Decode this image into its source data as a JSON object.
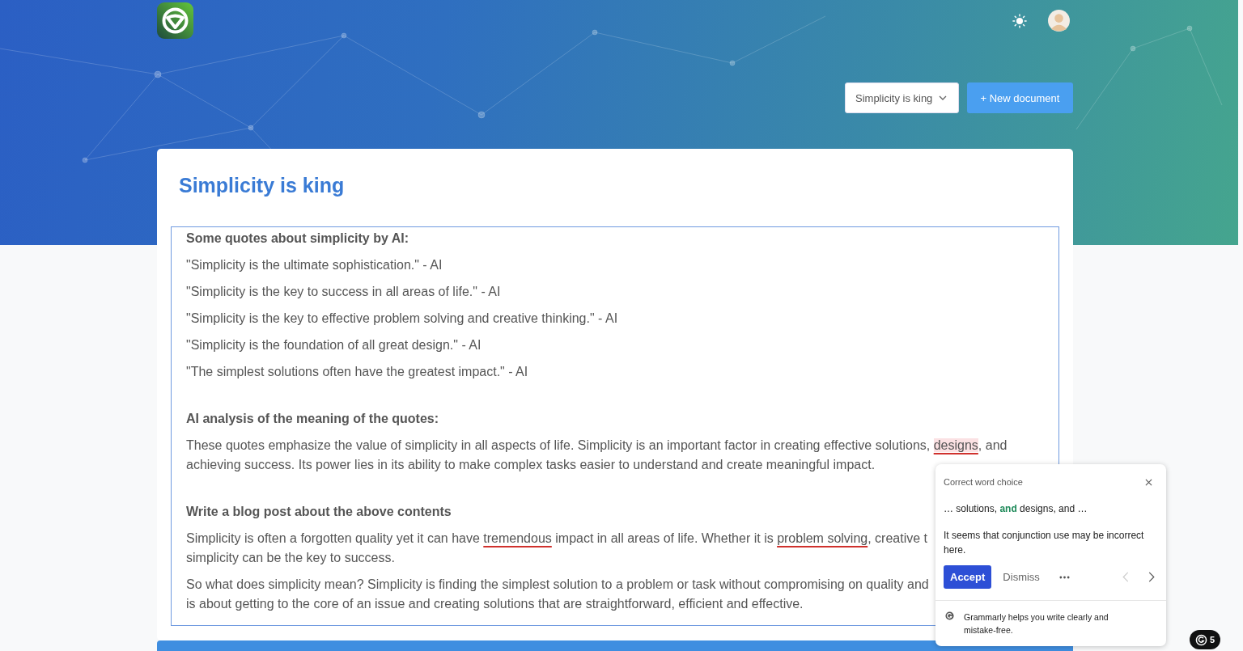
{
  "toolbar": {
    "document_select": {
      "value": "Simplicity is king"
    },
    "new_button": {
      "label": "+ New document"
    }
  },
  "document": {
    "title": "Simplicity is king",
    "sections": [
      {
        "heading": "Some quotes about simplicity by AI:",
        "paragraphs": [
          {
            "lines": [
              [
                {
                  "text": "\"Simplicity is the ultimate sophistication.\" - AI",
                  "kind": "plain"
                }
              ]
            ]
          },
          {
            "lines": [
              [
                {
                  "text": "\"Simplicity is the key to success in all areas of life.\" - AI",
                  "kind": "plain"
                }
              ]
            ]
          },
          {
            "lines": [
              [
                {
                  "text": "\"Simplicity is the key to effective problem solving and creative thinking.\" - AI",
                  "kind": "plain"
                }
              ]
            ]
          },
          {
            "lines": [
              [
                {
                  "text": "\"Simplicity is the foundation of all great design.\" - AI",
                  "kind": "plain"
                }
              ]
            ]
          },
          {
            "lines": [
              [
                {
                  "text": "\"The simplest solutions often have the greatest impact.\" - AI",
                  "kind": "plain"
                }
              ]
            ]
          }
        ]
      },
      {
        "heading": "AI analysis of the meaning of the quotes:",
        "paragraphs": [
          {
            "lines": [
              [
                {
                  "text": "These quotes emphasize the value of simplicity in all aspects of life. Simplicity is an important factor in creating effective solutions, ",
                  "kind": "plain"
                },
                {
                  "text": "designs",
                  "kind": "active"
                },
                {
                  "text": ", and",
                  "kind": "plain"
                }
              ],
              [
                {
                  "text": "achieving success. Its power lies in its ability to make complex tasks easier to understand and create meaningful impact.",
                  "kind": "plain"
                }
              ]
            ]
          }
        ]
      },
      {
        "heading": "Write a blog post about the above contents",
        "paragraphs": [
          {
            "lines": [
              [
                {
                  "text": "Simplicity is often a forgotten quality yet it can have ",
                  "kind": "plain"
                },
                {
                  "text": "tremendous",
                  "kind": "flagged"
                },
                {
                  "text": " impact in all areas of life. Whether it is ",
                  "kind": "plain"
                },
                {
                  "text": "problem solving",
                  "kind": "flagged"
                },
                {
                  "text": ", creative t",
                  "kind": "plain"
                }
              ],
              [
                {
                  "text": "simplicity can be the key to success.",
                  "kind": "plain"
                }
              ]
            ]
          },
          {
            "lines": [
              [
                {
                  "text": "So what does simplicity mean? Simplicity is finding the simplest solution to a problem or task without compromising on quality and",
                  "kind": "plain"
                }
              ],
              [
                {
                  "text": "is about getting to the core of an issue and creating solutions that are straightforward, efficient and effective.",
                  "kind": "plain"
                }
              ]
            ]
          }
        ]
      }
    ]
  },
  "suggestion_card": {
    "title": "Correct word choice",
    "preview": [
      {
        "text": "… solutions, ",
        "kind": "plain"
      },
      {
        "text": "and",
        "kind": "suggested"
      },
      {
        "text": " designs, and …",
        "kind": "plain"
      }
    ],
    "message": "It seems that conjunction use may be incorrect here.",
    "accept": "Accept",
    "dismiss": "Dismiss",
    "footer": "Grammarly helps you write clearly and mistake-free."
  },
  "grammarly_badge": {
    "count": "5"
  }
}
